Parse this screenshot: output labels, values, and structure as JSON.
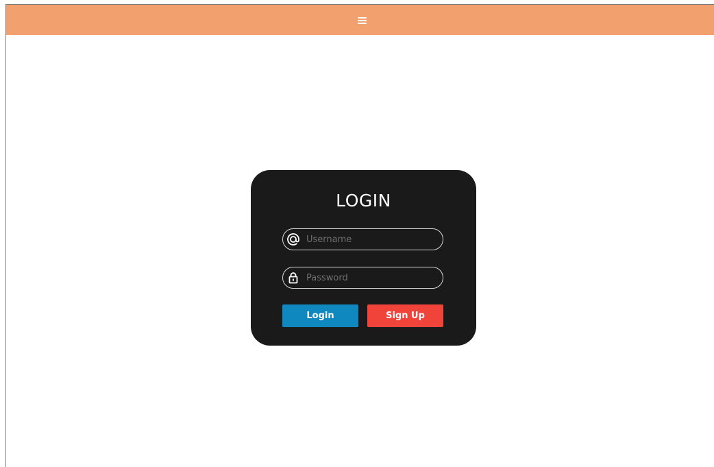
{
  "header": {
    "menu_icon": "hamburger-menu-icon",
    "background_color": "#f2a06e"
  },
  "login_card": {
    "title": "LOGIN",
    "background_color": "#1a1a1a",
    "username": {
      "icon": "at-sign-icon",
      "placeholder": "Username",
      "value": ""
    },
    "password": {
      "icon": "lock-icon",
      "placeholder": "Password",
      "value": ""
    },
    "login_button": {
      "label": "Login",
      "color": "#0f87bf"
    },
    "signup_button": {
      "label": "Sign Up",
      "color": "#f0433a"
    }
  }
}
